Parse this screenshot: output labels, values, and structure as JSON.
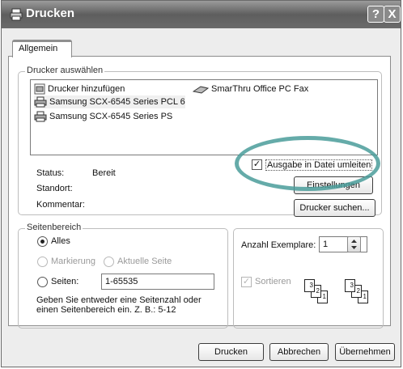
{
  "window": {
    "title": "Drucken",
    "help_btn": "?",
    "close_btn": "X"
  },
  "tabs": [
    {
      "label": "Allgemein"
    }
  ],
  "printer_group": {
    "legend": "Drucker auswählen",
    "printers": [
      {
        "name": "Drucker hinzufügen",
        "icon": "add-printer-icon"
      },
      {
        "name": "SmarThru Office PC Fax",
        "icon": "fax-icon"
      },
      {
        "name": "Samsung SCX-6545 Series PCL 6",
        "icon": "printer-icon"
      },
      {
        "name": "Samsung SCX-6545 Series PS",
        "icon": "printer-icon"
      }
    ],
    "status_label": "Status:",
    "status_value": "Bereit",
    "location_label": "Standort:",
    "comment_label": "Kommentar:",
    "print_to_file_label": "Ausgabe in Datei umleiten",
    "print_to_file_checked": true,
    "settings_button": "Einstellungen",
    "find_printer_button": "Drucker suchen..."
  },
  "range_group": {
    "legend": "Seitenbereich",
    "all_label": "Alles",
    "selection_label": "Markierung",
    "current_page_label": "Aktuelle Seite",
    "pages_label": "Seiten:",
    "pages_value": "1-65535",
    "hint": "Geben Sie entweder eine Seitenzahl oder einen Seitenbereich ein. Z. B.: 5-12",
    "selected": "Alles"
  },
  "copies_group": {
    "copies_label": "Anzahl Exemplare:",
    "copies_value": "1",
    "collate_label": "Sortieren",
    "collate_checked": true,
    "collate_pages": [
      "1",
      "2",
      "3",
      "1",
      "2",
      "3"
    ]
  },
  "footer": {
    "print_button": "Drucken",
    "cancel_button": "Abbrechen",
    "apply_button": "Übernehmen"
  },
  "colors": {
    "highlight": "#4a9c9a",
    "title_bar": "#6b6b6b"
  }
}
